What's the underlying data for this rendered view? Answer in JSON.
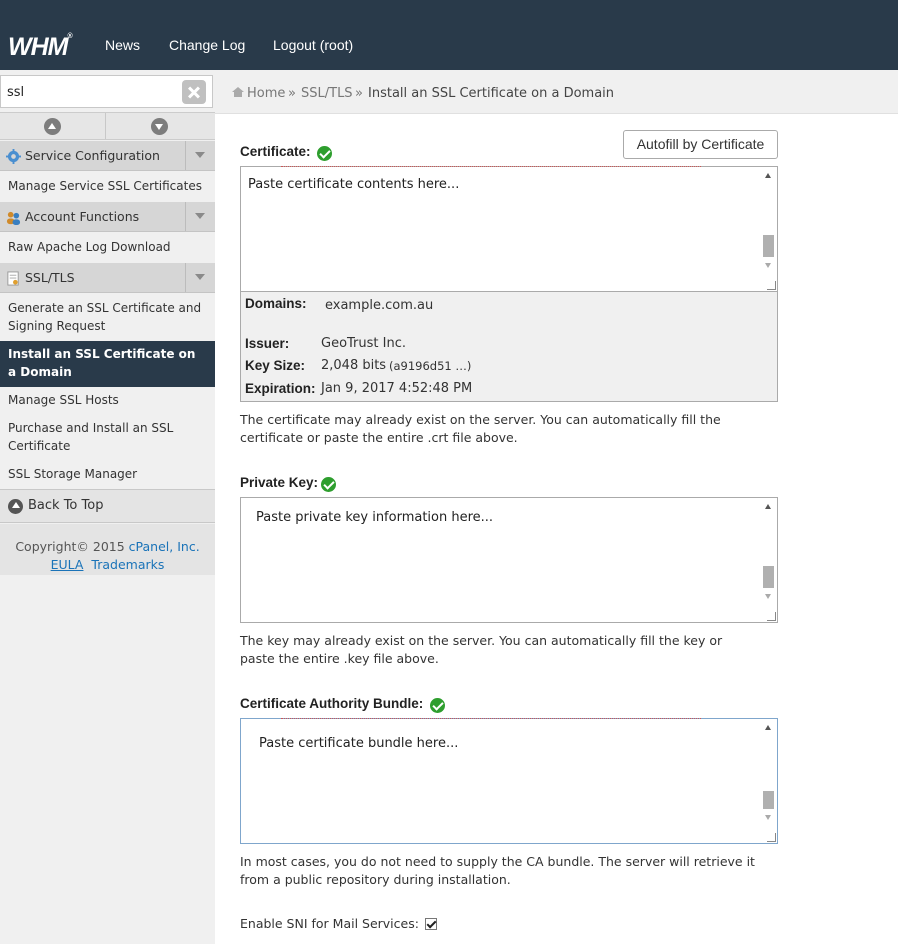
{
  "header": {
    "logo": "WHM",
    "logo_mark": "®",
    "nav": [
      "News",
      "Change Log",
      "Logout (root)"
    ]
  },
  "sidebar": {
    "search_value": "ssl",
    "categories": [
      {
        "label": "Service Configuration",
        "icon": "gear-icon",
        "items": [
          "Manage Service SSL Certificates"
        ]
      },
      {
        "label": "Account Functions",
        "icon": "users-icon",
        "items": [
          "Raw Apache Log Download"
        ]
      },
      {
        "label": "SSL/TLS",
        "icon": "document-icon",
        "items": [
          "Generate an SSL Certificate and Signing Request",
          "Install an SSL Certificate on a Domain",
          "Manage SSL Hosts",
          "Purchase and Install an SSL Certificate",
          "SSL Storage Manager"
        ]
      }
    ],
    "back_to_top": "Back To Top",
    "footer": {
      "copyright": "Copyright© 2015",
      "company": "cPanel, Inc.",
      "eula": "EULA",
      "trademarks": "Trademarks"
    }
  },
  "breadcrumb": {
    "home": "Home",
    "sep": "»",
    "section": "SSL/TLS",
    "current": "Install an SSL Certificate on a Domain"
  },
  "form": {
    "autofill_label": "Autofill by Certificate",
    "certificate": {
      "label": "Certificate:",
      "placeholder": "Paste certificate contents here...",
      "info": {
        "domains_label": "Domains:",
        "domains": "example.com.au",
        "issuer_label": "Issuer:",
        "issuer": "GeoTrust Inc.",
        "keysize_label": "Key Size:",
        "keysize": "2,048 bits",
        "keyid": "(a9196d51 …)",
        "expiration_label": "Expiration:",
        "expiration": "Jan 9, 2017 4:52:48 PM"
      },
      "help": "The certificate may already exist on the server. You can automatically fill the certificate or paste the entire .crt file above."
    },
    "private_key": {
      "label": "Private Key:",
      "placeholder": "Paste private key information here...",
      "help": "The key may already exist on the server. You can automatically fill the key or paste the entire .key file above."
    },
    "ca_bundle": {
      "label": "Certificate Authority Bundle:",
      "placeholder": "Paste certificate bundle here...",
      "help": "In most cases, you do not need to supply the CA bundle. The server will retrieve it from a public repository during installation."
    },
    "sni_label": "Enable SNI for Mail Services:",
    "sni_checked": true
  }
}
